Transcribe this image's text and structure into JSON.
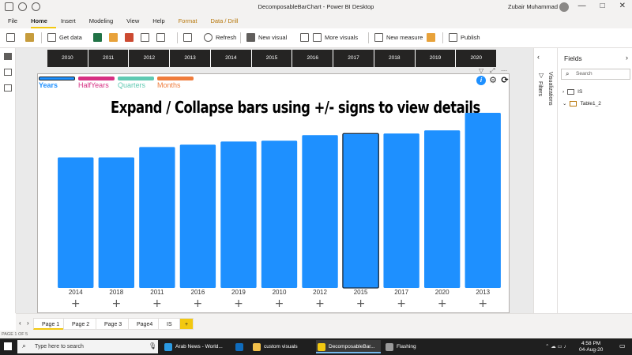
{
  "window": {
    "title": "DecomposableBarChart - Power BI Desktop",
    "user": "Zubair Muhammad",
    "controls": [
      "—",
      "□",
      "✕"
    ]
  },
  "menu": [
    "File",
    "Home",
    "Insert",
    "Modeling",
    "View",
    "Help",
    "Format",
    "Data / Drill"
  ],
  "ribbon": {
    "get_data": "Get data",
    "refresh": "Refresh",
    "new_visual": "New visual",
    "more_visuals": "More visuals",
    "new_measure": "New measure",
    "publish": "Publish"
  },
  "slicer_years": [
    "2010",
    "2011",
    "2012",
    "2013",
    "2014",
    "2015",
    "2016",
    "2017",
    "2018",
    "2019",
    "2020"
  ],
  "legend": [
    {
      "label": "Years",
      "color": "#1e90ff"
    },
    {
      "label": "HalfYears",
      "color": "#d62f82"
    },
    {
      "label": "Quarters",
      "color": "#5fc9b2"
    },
    {
      "label": "Months",
      "color": "#ef7c3c"
    }
  ],
  "chart_title": "Expand / Collapse bars using +/-  signs to view details",
  "expand_symbol": "+",
  "chart_data": {
    "type": "bar",
    "title": "Expand / Collapse bars using +/-  signs to view details",
    "categories": [
      "2014",
      "2018",
      "2011",
      "2016",
      "2019",
      "2010",
      "2012",
      "2015",
      "2017",
      "2020",
      "2013"
    ],
    "values": [
      164,
      164,
      177,
      180,
      184,
      185,
      192,
      194,
      194,
      198,
      220
    ],
    "bar_color": "#1e90ff",
    "highlighted": "2015",
    "xlabel": "",
    "ylabel": ""
  },
  "pages": [
    "Page 1",
    "Page 2",
    "Page 3",
    "Page4",
    "IS",
    "+"
  ],
  "status": "PAGE 1 OF 5",
  "panes": {
    "filters": "Filters",
    "visualizations": "Visualizations",
    "fields": "Fields",
    "search_placeholder": "Search",
    "tables": [
      "IS",
      "Table1_2"
    ]
  },
  "taskbar": {
    "search_placeholder": "Type here to search",
    "apps": [
      "Arab News - World...",
      "custom visuals",
      "DecomposableBar...",
      "Flashing"
    ],
    "time": "4:58 PM",
    "date": "04-Aug-20"
  }
}
